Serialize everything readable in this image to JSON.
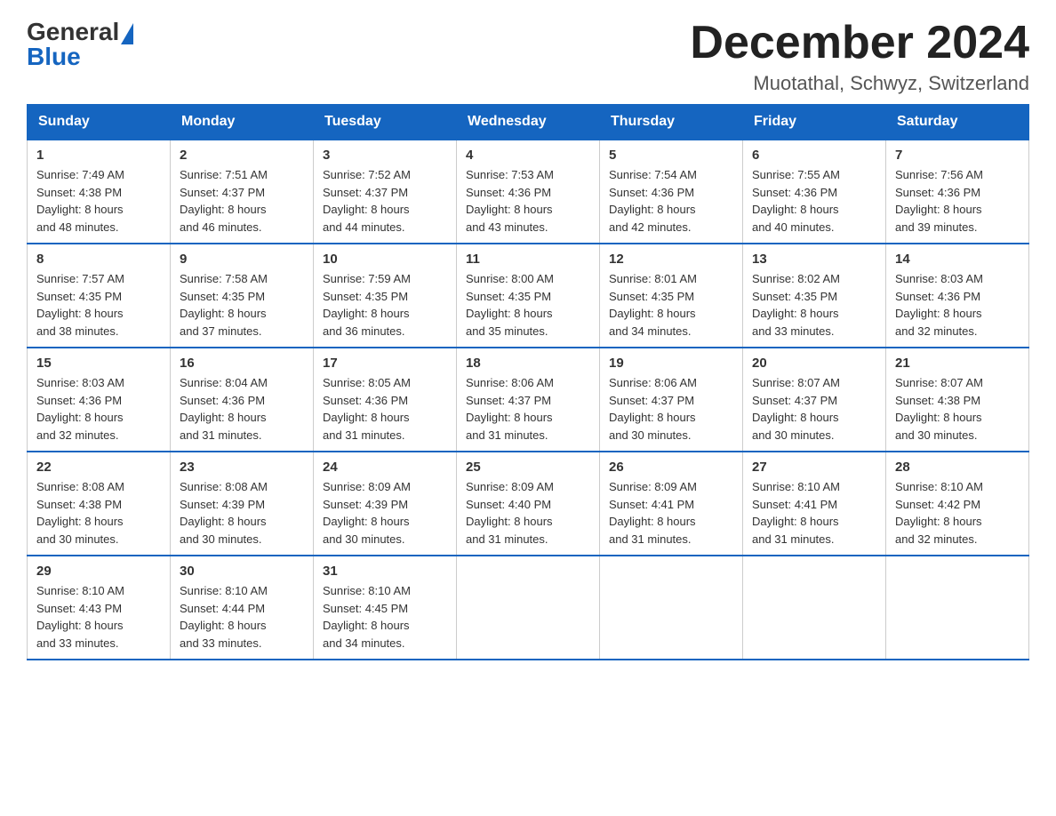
{
  "header": {
    "logo_general": "General",
    "logo_blue": "Blue",
    "title": "December 2024",
    "location": "Muotathal, Schwyz, Switzerland"
  },
  "weekdays": [
    "Sunday",
    "Monday",
    "Tuesday",
    "Wednesday",
    "Thursday",
    "Friday",
    "Saturday"
  ],
  "weeks": [
    [
      {
        "day": "1",
        "sunrise": "7:49 AM",
        "sunset": "4:38 PM",
        "daylight": "8 hours and 48 minutes."
      },
      {
        "day": "2",
        "sunrise": "7:51 AM",
        "sunset": "4:37 PM",
        "daylight": "8 hours and 46 minutes."
      },
      {
        "day": "3",
        "sunrise": "7:52 AM",
        "sunset": "4:37 PM",
        "daylight": "8 hours and 44 minutes."
      },
      {
        "day": "4",
        "sunrise": "7:53 AM",
        "sunset": "4:36 PM",
        "daylight": "8 hours and 43 minutes."
      },
      {
        "day": "5",
        "sunrise": "7:54 AM",
        "sunset": "4:36 PM",
        "daylight": "8 hours and 42 minutes."
      },
      {
        "day": "6",
        "sunrise": "7:55 AM",
        "sunset": "4:36 PM",
        "daylight": "8 hours and 40 minutes."
      },
      {
        "day": "7",
        "sunrise": "7:56 AM",
        "sunset": "4:36 PM",
        "daylight": "8 hours and 39 minutes."
      }
    ],
    [
      {
        "day": "8",
        "sunrise": "7:57 AM",
        "sunset": "4:35 PM",
        "daylight": "8 hours and 38 minutes."
      },
      {
        "day": "9",
        "sunrise": "7:58 AM",
        "sunset": "4:35 PM",
        "daylight": "8 hours and 37 minutes."
      },
      {
        "day": "10",
        "sunrise": "7:59 AM",
        "sunset": "4:35 PM",
        "daylight": "8 hours and 36 minutes."
      },
      {
        "day": "11",
        "sunrise": "8:00 AM",
        "sunset": "4:35 PM",
        "daylight": "8 hours and 35 minutes."
      },
      {
        "day": "12",
        "sunrise": "8:01 AM",
        "sunset": "4:35 PM",
        "daylight": "8 hours and 34 minutes."
      },
      {
        "day": "13",
        "sunrise": "8:02 AM",
        "sunset": "4:35 PM",
        "daylight": "8 hours and 33 minutes."
      },
      {
        "day": "14",
        "sunrise": "8:03 AM",
        "sunset": "4:36 PM",
        "daylight": "8 hours and 32 minutes."
      }
    ],
    [
      {
        "day": "15",
        "sunrise": "8:03 AM",
        "sunset": "4:36 PM",
        "daylight": "8 hours and 32 minutes."
      },
      {
        "day": "16",
        "sunrise": "8:04 AM",
        "sunset": "4:36 PM",
        "daylight": "8 hours and 31 minutes."
      },
      {
        "day": "17",
        "sunrise": "8:05 AM",
        "sunset": "4:36 PM",
        "daylight": "8 hours and 31 minutes."
      },
      {
        "day": "18",
        "sunrise": "8:06 AM",
        "sunset": "4:37 PM",
        "daylight": "8 hours and 31 minutes."
      },
      {
        "day": "19",
        "sunrise": "8:06 AM",
        "sunset": "4:37 PM",
        "daylight": "8 hours and 30 minutes."
      },
      {
        "day": "20",
        "sunrise": "8:07 AM",
        "sunset": "4:37 PM",
        "daylight": "8 hours and 30 minutes."
      },
      {
        "day": "21",
        "sunrise": "8:07 AM",
        "sunset": "4:38 PM",
        "daylight": "8 hours and 30 minutes."
      }
    ],
    [
      {
        "day": "22",
        "sunrise": "8:08 AM",
        "sunset": "4:38 PM",
        "daylight": "8 hours and 30 minutes."
      },
      {
        "day": "23",
        "sunrise": "8:08 AM",
        "sunset": "4:39 PM",
        "daylight": "8 hours and 30 minutes."
      },
      {
        "day": "24",
        "sunrise": "8:09 AM",
        "sunset": "4:39 PM",
        "daylight": "8 hours and 30 minutes."
      },
      {
        "day": "25",
        "sunrise": "8:09 AM",
        "sunset": "4:40 PM",
        "daylight": "8 hours and 31 minutes."
      },
      {
        "day": "26",
        "sunrise": "8:09 AM",
        "sunset": "4:41 PM",
        "daylight": "8 hours and 31 minutes."
      },
      {
        "day": "27",
        "sunrise": "8:10 AM",
        "sunset": "4:41 PM",
        "daylight": "8 hours and 31 minutes."
      },
      {
        "day": "28",
        "sunrise": "8:10 AM",
        "sunset": "4:42 PM",
        "daylight": "8 hours and 32 minutes."
      }
    ],
    [
      {
        "day": "29",
        "sunrise": "8:10 AM",
        "sunset": "4:43 PM",
        "daylight": "8 hours and 33 minutes."
      },
      {
        "day": "30",
        "sunrise": "8:10 AM",
        "sunset": "4:44 PM",
        "daylight": "8 hours and 33 minutes."
      },
      {
        "day": "31",
        "sunrise": "8:10 AM",
        "sunset": "4:45 PM",
        "daylight": "8 hours and 34 minutes."
      },
      null,
      null,
      null,
      null
    ]
  ],
  "labels": {
    "sunrise": "Sunrise:",
    "sunset": "Sunset:",
    "daylight": "Daylight:"
  }
}
